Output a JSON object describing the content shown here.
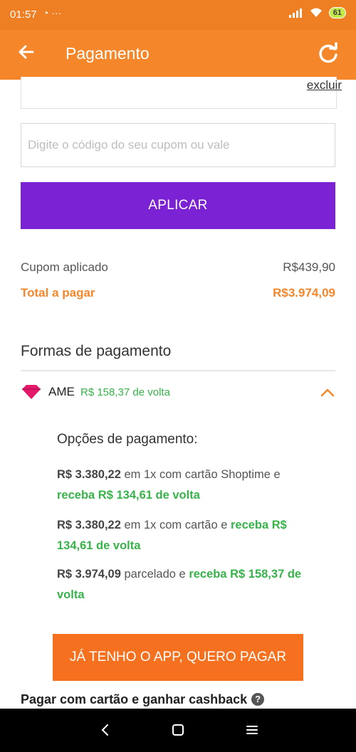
{
  "status_bar": {
    "time": "01:57",
    "left_icons": "◔ ···",
    "battery": "61"
  },
  "header": {
    "title": "Pagamento"
  },
  "coupon": {
    "remove_link": "excluir",
    "input_placeholder": "Digite o código do seu cupom ou vale",
    "apply_label": "APLICAR"
  },
  "summary": {
    "coupon_label": "Cupom aplicado",
    "coupon_value": "R$439,90",
    "total_label": "Total a pagar",
    "total_value": "R$3.974,09"
  },
  "payment": {
    "section_title": "Formas de pagamento",
    "ame": {
      "name": "AME",
      "cashback": "R$ 158,37 de volta",
      "options_title": "Opções de pagamento:",
      "option1": {
        "price": "R$ 3.380,22",
        "text": " em 1x com cartão Shoptime e ",
        "green": "receba R$ 134,61 de volta"
      },
      "option2": {
        "price": "R$ 3.380,22",
        "text": " em 1x com cartão e ",
        "green": "receba R$ 134,61 de volta"
      },
      "option3": {
        "price": "R$ 3.974,09",
        "text": " parcelado e ",
        "green": "receba R$ 158,37 de volta"
      },
      "app_button_label": "JÁ TENHO O APP, QUERO PAGAR"
    },
    "card_cashback_title": "Pagar com cartão e ganhar cashback",
    "help_icon": "?"
  },
  "colors": {
    "status_bar": "#ee7f22",
    "app_bar": "#f5872a",
    "apply_button": "#7a22d4",
    "green": "#37b34a",
    "app_button": "#f5701f"
  },
  "icons": {
    "back": "arrow-left-icon",
    "refresh": "refresh-icon",
    "ame": "ame-diamond-icon",
    "expand": "chevron-up-icon",
    "help": "help-icon"
  }
}
